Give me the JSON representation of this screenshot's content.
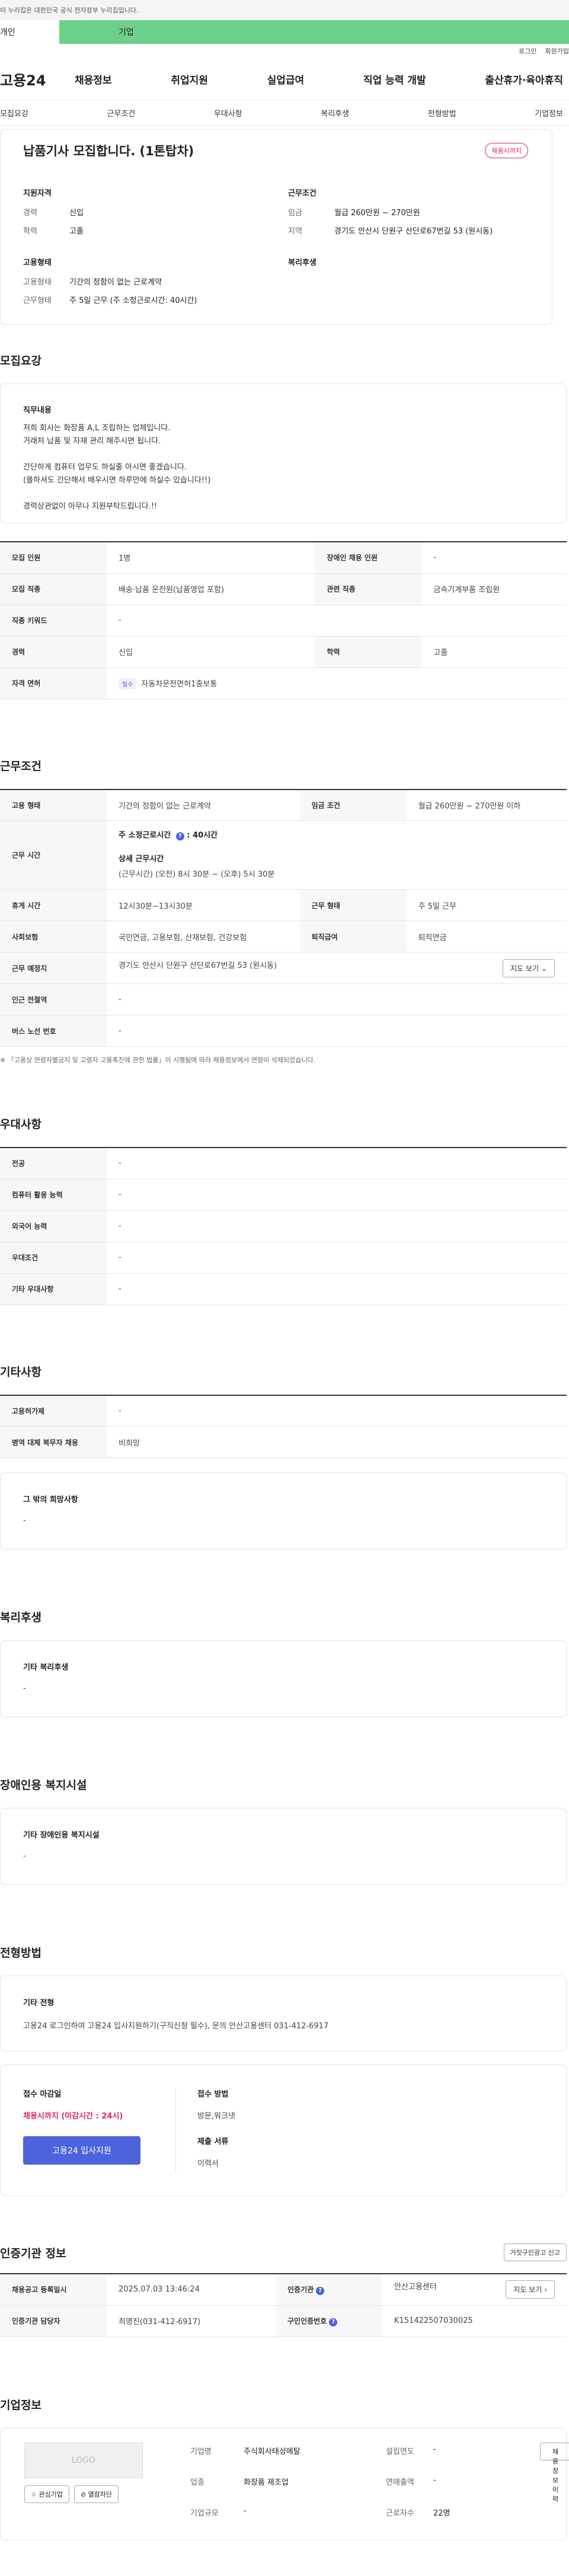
{
  "gov_banner": "이 누리집은 대한민국 공식 전자정부 누리집입니다.",
  "top_tabs": {
    "individual": "개인",
    "business": "기업"
  },
  "util": {
    "login": "로그인",
    "signup": "회원가입"
  },
  "logo": "고용24",
  "gnb": [
    "채용정보",
    "취업지원",
    "실업급여",
    "직업 능력 개발",
    "출산휴가·육아휴직"
  ],
  "subnav": [
    "모집요강",
    "근무조건",
    "우대사항",
    "복리후생",
    "전형방법",
    "기업정보"
  ],
  "hero": {
    "title": "납품기사 모집합니다. (1톤탑차)",
    "badge": "채용시까지",
    "qual_title": "지원자격",
    "career_k": "경력",
    "career_v": "신입",
    "edu_k": "학력",
    "edu_v": "고졸",
    "cond_title": "근무조건",
    "wage_k": "임금",
    "wage_v": "월급 260만원 ~ 270만원",
    "loc_k": "지역",
    "loc_v": "경기도 안산시 단원구 산단로67번길 53 (원시동)",
    "emp_title": "고용형태",
    "emptype_k": "고용형태",
    "emptype_v": "기간의 정함이 없는 근로계약",
    "worktype_k": "근무형태",
    "worktype_v": "주 5일 근무 (주 소정근로시간: 40시간)",
    "welfare_title": "복리후생"
  },
  "recruit": {
    "title": "모집요강",
    "duty_title": "직무내용",
    "duty_lines": [
      "저희 회사는 화장품 A,L 조립하는 업체입니다.",
      "거래처 납품 및 자재 관리 해주시면 됩니다.",
      "",
      "간단하게 컴퓨터 업무도 하실줄 아시면 좋겠습니다.",
      "(몰하셔도 간단해서 배우시면 하루만에 하실수 있습니다!!)",
      "",
      "경력상관없이 아무나 지원부탁드립니다.!!"
    ],
    "rows": [
      {
        "k1": "모집 인원",
        "v1": "1명",
        "k2": "장애인 채용 인원",
        "v2": "-"
      },
      {
        "k1": "모집 직종",
        "v1": "배송·납품 운전원(납품영업 포함)",
        "k2": "관련 직종",
        "v2": "금속기계부품 조립원"
      },
      {
        "k1": "직종 키워드",
        "v1": "-"
      },
      {
        "k1": "경력",
        "v1": "신입",
        "k2": "학력",
        "v2": "고졸"
      },
      {
        "k1": "자격 면허",
        "tag": "필수",
        "v1": "자동차운전면허1종보통"
      }
    ]
  },
  "cond": {
    "title": "근무조건",
    "emp_k": "고용 형태",
    "emp_v": "기간의 정함이 없는 근로계약",
    "wage_k": "임금 조건",
    "wage_v": "월급 260만원 ~ 270만원 이하",
    "time_k": "근무 시간",
    "time_v1": "주 소정근로시간",
    "time_v1b": "40시간",
    "time_v2": "상세 근무시간",
    "time_v3": "(근무시간) (오전) 8시 30분 ~ (오후) 5시 30분",
    "rest_k": "휴게 시간",
    "rest_v": "12시30분~13시30분",
    "type_k": "근무 형태",
    "type_v": "주 5일 근무",
    "ins_k": "사회보험",
    "ins_v": "국민연금, 고용보험, 산재보험, 건강보험",
    "ret_k": "퇴직급여",
    "ret_v": "퇴직연금",
    "place_k": "근무 예정지",
    "place_v": "경기도 안산시 단원구 산단로67번길 53 (원시동)",
    "map_btn": "지도 보기 ⌄",
    "station_k": "인근 전철역",
    "station_v": "-",
    "bus_k": "버스 노선 번호",
    "bus_v": "-",
    "note": "※ 「고용상 연령차별금지 및 고령자 고용촉진에 관한 법률」이 시행됨에 따라 채용정보에서 연령이 삭제되었습니다."
  },
  "pref": {
    "title": "우대사항",
    "rows": [
      [
        "전공",
        "-"
      ],
      [
        "컴퓨터 활용 능력",
        "-"
      ],
      [
        "외국어 능력",
        "-"
      ],
      [
        "우대조건",
        "-"
      ],
      [
        "기타 우대사항",
        "-"
      ]
    ]
  },
  "etc": {
    "title": "기타사항",
    "rows": [
      [
        "고용허가제",
        "-"
      ],
      [
        "병역 대체 복무자 채용",
        "비희망"
      ]
    ],
    "other_title": "그 밖의 희망사항",
    "other_v": "-"
  },
  "welfare": {
    "title": "복리후생",
    "box_title": "기타 복리후생",
    "box_v": "-"
  },
  "disab": {
    "title": "장애인용 복지시설",
    "box_title": "기타 장애인용 복지시설",
    "box_v": "-"
  },
  "selection": {
    "title": "전형방법",
    "box_title": "기타 전형",
    "box_v": "고용24 로그인하여 고용24 입사지원하기(구직신청 필수), 문의 안산고용센터 031-412-6917",
    "deadline_k": "접수 마감일",
    "deadline_v": "채용시까지 (마감시간 : 24시)",
    "apply_btn": "고용24 입사지원",
    "method_k": "접수 방법",
    "method_v": "방문,워크넷",
    "docs_k": "제출 서류",
    "docs_v": "이력서"
  },
  "agency": {
    "title": "인증기관 정보",
    "report_btn": "거짓구인광고 신고",
    "reg_k": "채용공고 등록일시",
    "reg_v": "2025.07.03 13:46:24",
    "org_k": "인증기관",
    "org_v": "안산고용센터",
    "map_btn": "지도 보기 ›",
    "mgr_k": "인증기관 담당자",
    "mgr_v": "최명진(031-412-6917)",
    "no_k": "구인인증번호",
    "no_v": "K151422507030025"
  },
  "company": {
    "title": "기업정보",
    "logo": "LOGO",
    "fav_btn": "☆ 관심기업",
    "block_btn": "⊘ 열람차단",
    "name_k": "기업명",
    "name_v": "주식회사태성메탈",
    "est_k": "설립연도",
    "est_v": "-",
    "ind_k": "업종",
    "ind_v": "화장품 제조업",
    "sales_k": "연매출액",
    "sales_v": "-",
    "size_k": "기업규모",
    "size_v": "-",
    "emp_k": "근로자수",
    "emp_v": "22명",
    "info_btn": "채용정보 이력"
  }
}
